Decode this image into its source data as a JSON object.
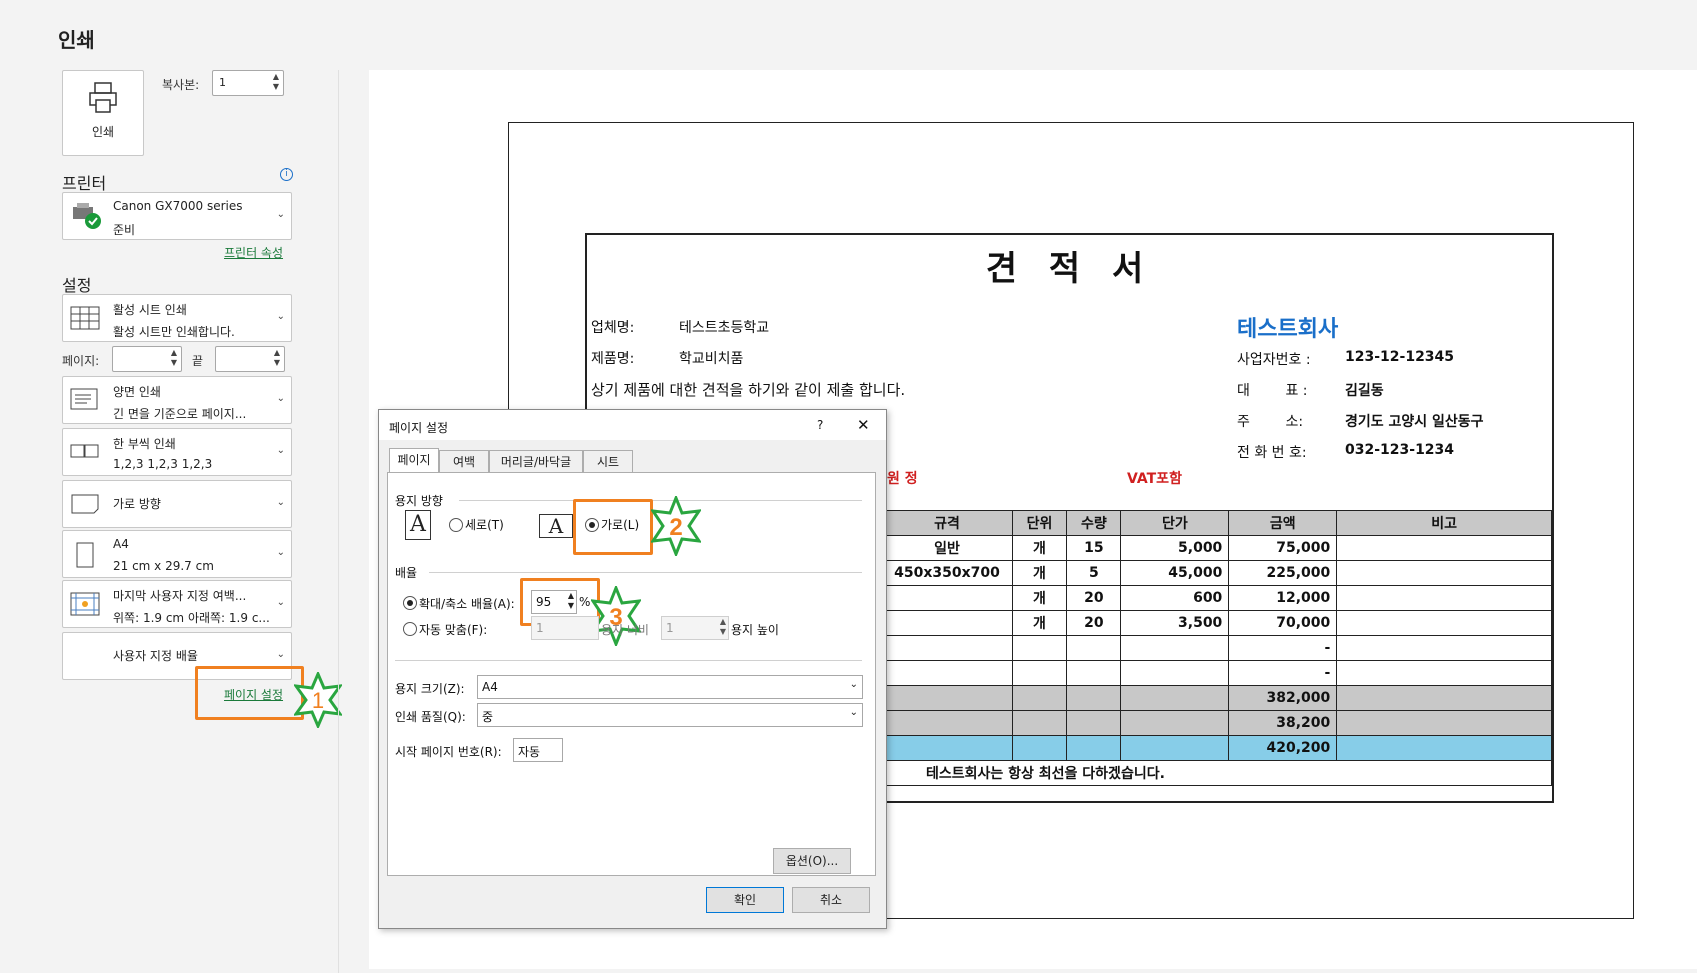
{
  "panel": {
    "title": "인쇄",
    "print_button": "인쇄",
    "copies_label": "복사본:",
    "copies_value": "1",
    "printer_header": "프린터",
    "printer_name": "Canon GX7000 series",
    "printer_status": "준비",
    "printer_props": "프린터 속성",
    "settings_header": "설정",
    "settings": [
      {
        "l1": "활성 시트 인쇄",
        "l2": "활성 시트만 인쇄합니다."
      },
      {
        "l1": "양면 인쇄",
        "l2": "긴 면을 기준으로 페이지..."
      },
      {
        "l1": "한 부씩 인쇄",
        "l2": "1,2,3    1,2,3    1,2,3"
      },
      {
        "l1": "가로 방향",
        "l2": ""
      },
      {
        "l1": "A4",
        "l2": "21 cm x 29.7 cm"
      },
      {
        "l1": "마지막 사용자 지정 여백...",
        "l2": "위쪽: 1.9 cm 아래쪽: 1.9 c..."
      },
      {
        "l1": "사용자 지정 배율",
        "l2": ""
      }
    ],
    "pages_label": "페이지:",
    "to_label": "끝",
    "page_setup_link": "페이지 설정"
  },
  "quote": {
    "title": "견 적 서",
    "vendor_label": "업체명:",
    "vendor_value": "테스트초등학교",
    "product_label": "제품명:",
    "product_value": "학교비치품",
    "statement": "상기 제품에 대한 견적을 하기와 같이 제출 합니다.",
    "amount_suffix": "원 정",
    "vat": "VAT포함",
    "company": "테스트회사",
    "biz_label": "사업자번호 :",
    "biz_value": "123-12-12345",
    "rep_label": "대        표 :",
    "rep_value": "김길동",
    "addr_label": "주        소:",
    "addr_value": "경기도 고양시 일산동구",
    "tel_label": "전 화 번 호:",
    "tel_value": "032-123-1234",
    "footer": "테스트회사는 항상 최선을 다하겠습니다.",
    "table": {
      "headers": [
        "규격",
        "단위",
        "수량",
        "단가",
        "금액",
        "비고"
      ],
      "rows": [
        [
          "일반",
          "개",
          "15",
          "5,000",
          "75,000",
          ""
        ],
        [
          "450x350x700",
          "개",
          "5",
          "45,000",
          "225,000",
          ""
        ],
        [
          "",
          "개",
          "20",
          "600",
          "12,000",
          ""
        ],
        [
          "",
          "개",
          "20",
          "3,500",
          "70,000",
          ""
        ],
        [
          "",
          "",
          "",
          "",
          "-",
          ""
        ],
        [
          "",
          "",
          "",
          "",
          "-",
          ""
        ]
      ],
      "subtotal": "382,000",
      "tax": "38,200",
      "total": "420,200"
    }
  },
  "dialog": {
    "title": "페이지 설정",
    "help": "?",
    "close": "✕",
    "tabs": [
      "페이지",
      "여백",
      "머리글/바닥글",
      "시트"
    ],
    "orientation_label": "용지 방향",
    "portrait": "세로(T)",
    "landscape": "가로(L)",
    "scaling_label": "배율",
    "adjust_label": "확대/축소 배율(A):",
    "adjust_value": "95",
    "percent": "%",
    "fit_label": "자동 맞춤(F):",
    "fit_wide_value": "1",
    "fit_wide_label": "용지 너비",
    "fit_tall_value": "1",
    "fit_tall_label": "용지 높이",
    "paper_size_label": "용지 크기(Z):",
    "paper_size_value": "A4",
    "quality_label": "인쇄 품질(Q):",
    "quality_value": "중",
    "first_page_label": "시작 페이지 번호(R):",
    "first_page_value": "자동",
    "options_button": "옵션(O)...",
    "ok_button": "확인",
    "cancel_button": "취소"
  },
  "annotations": {
    "step1": "1",
    "step2": "2",
    "step3": "3",
    "highlight_color": "#f08020",
    "star_color": "#2aa640"
  }
}
